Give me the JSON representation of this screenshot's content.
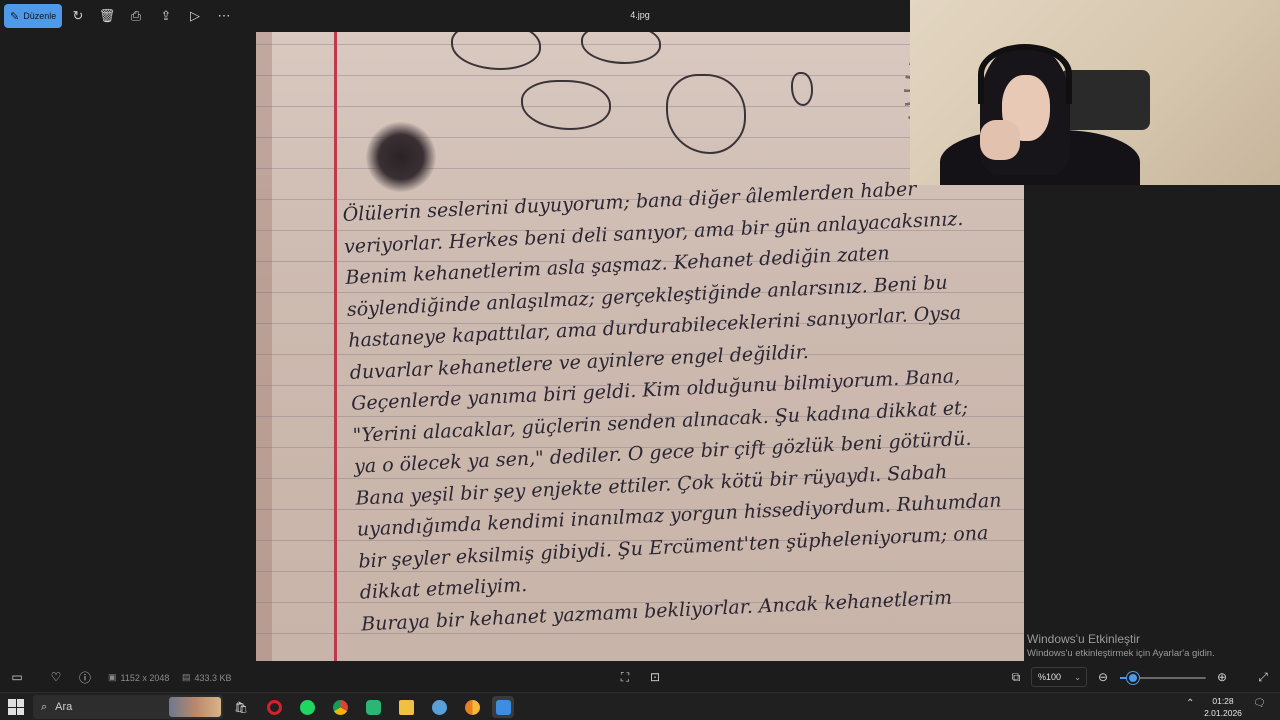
{
  "toolbar": {
    "edit_label": "Düzenle",
    "file_title": "4.jpg",
    "icons": [
      "rotate-icon",
      "delete-icon",
      "print-icon",
      "share-icon",
      "slideshow-icon",
      "more-icon"
    ]
  },
  "photo": {
    "text_lines": [
      "Ölülerin seslerini duyuyorum; bana diğer âlemlerden haber",
      "veriyorlar. Herkes beni deli sanıyor, ama bir gün anlayacaksınız.",
      "Benim kehanetlerim asla şaşmaz. Kehanet dediğin zaten",
      "söylendiğinde anlaşılmaz; gerçekleştiğinde anlarsınız. Beni bu",
      "hastaneye kapattılar, ama durdurabileceklerini sanıyorlar. Oysa",
      "duvarlar kehanetlere ve ayinlere engel değildir.",
      "Geçenlerde yanıma biri geldi. Kim olduğunu bilmiyorum. Bana,",
      "\"Yerini alacaklar, güçlerin senden alınacak. Şu kadına dikkat et;",
      "ya o ölecek ya sen,\" dediler. O gece bir çift gözlük beni götürdü.",
      "Bana yeşil bir şey enjekte ettiler. Çok kötü bir rüyaydı. Sabah",
      "uyandığımda kendimi inanılmaz yorgun hissediyordum. Ruhumdan",
      "bir şeyler eksilmiş gibiydi. Şu Ercüment'ten şüpheleniyorum; ona",
      "dikkat etmeliyim.",
      "Buraya bir kehanet yazmamı bekliyorlar. Ancak kehanetlerim"
    ]
  },
  "infobar": {
    "dimensions": "1152 x 2048",
    "file_size": "433.3 KB",
    "zoom_value": "%100",
    "zoom_fraction": 0.15
  },
  "watermark": {
    "title": "Windows'u Etkinleştir",
    "subtitle": "Windows'u etkinleştirmek için Ayarlar'a gidin."
  },
  "taskbar": {
    "search_placeholder": "Ara",
    "time": "01:28",
    "date": "2.01.2026",
    "apps": [
      "store-icon",
      "opera-icon",
      "spotify-icon",
      "chrome-icon",
      "terminal-icon",
      "file-explorer-icon",
      "settings-icon",
      "chrome-canary-icon",
      "photos-icon"
    ]
  }
}
